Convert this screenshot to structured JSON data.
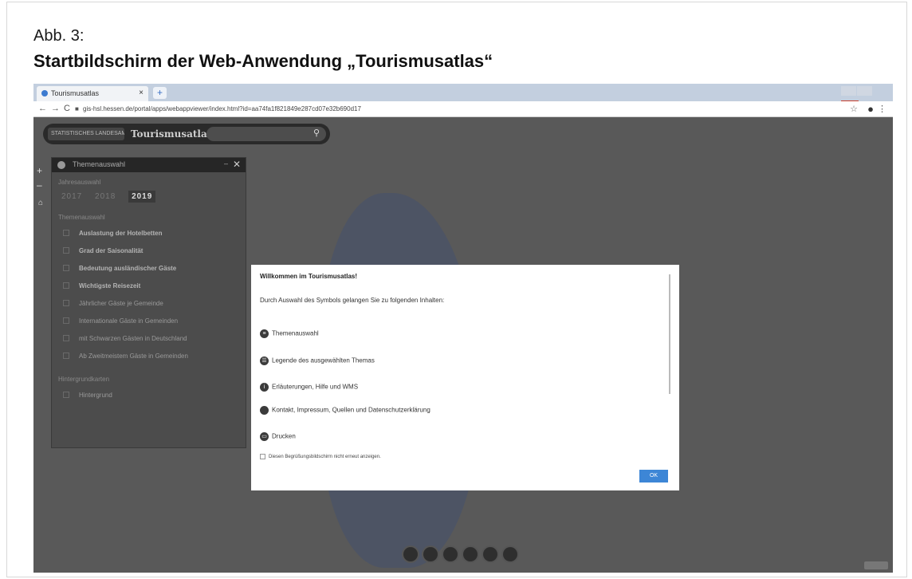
{
  "figure": {
    "label": "Abb. 3:",
    "title": "Startbildschirm der Web-Anwendung „Tourismusatlas“"
  },
  "browser": {
    "tab_title": "Tourismusatlas",
    "tab_close": "×",
    "new_tab": "+",
    "url": "gis-hsl.hessen.de/portal/apps/webappviewer/index.html?id=aa74fa1f821849e287cd07e32b690d17"
  },
  "app": {
    "logo_text": "STATISTISCHES LANDESAMT",
    "title": "Tourismusatlas"
  },
  "panel": {
    "header": "Themenauswahl",
    "year_label": "Jahresauswahl",
    "years": [
      "2017",
      "2018",
      "2019"
    ],
    "selected_year": "2019",
    "theme_label": "Themenauswahl",
    "themes": [
      {
        "label": "Auslastung der Hotelbetten",
        "bold": true
      },
      {
        "label": "Grad der Saisonalität",
        "bold": true
      },
      {
        "label": "Bedeutung ausländischer Gäste",
        "bold": true
      },
      {
        "label": "Wichtigste Reisezeit",
        "bold": true
      },
      {
        "label": "Jährlicher Gäste je Gemeinde",
        "bold": false
      },
      {
        "label": "Internationale Gäste in Gemeinden",
        "bold": false
      },
      {
        "label": "mit Schwarzen Gästen in Deutschland",
        "bold": false
      },
      {
        "label": "Ab Zweitmeistem Gäste in Gemeinden",
        "bold": false
      }
    ],
    "background_label": "Hintergrundkarten",
    "background_item": "Hintergrund"
  },
  "dialog": {
    "title": "Willkommen im Tourismusatlas!",
    "intro": "Durch Auswahl des Symbols gelangen Sie zu folgenden Inhalten:",
    "items": [
      {
        "label": "Themenauswahl",
        "icon": "layers-icon"
      },
      {
        "label": "Legende des ausgewählten Themas",
        "icon": "legend-icon"
      },
      {
        "label": "Erläuterungen, Hilfe und WMS",
        "icon": "info-icon"
      },
      {
        "label": "Kontakt, Impressum, Quellen und Datenschutzerklärung",
        "icon": "contact-icon"
      },
      {
        "label": "Drucken",
        "icon": "print-icon"
      }
    ],
    "checkbox_label": "Diesen Begrüßungsbildschirm nicht erneut anzeigen.",
    "ok_label": "OK"
  },
  "colors": {
    "accent": "#3d86d6",
    "map_bg": "#595959",
    "panel_bg": "#4c4c4c"
  }
}
